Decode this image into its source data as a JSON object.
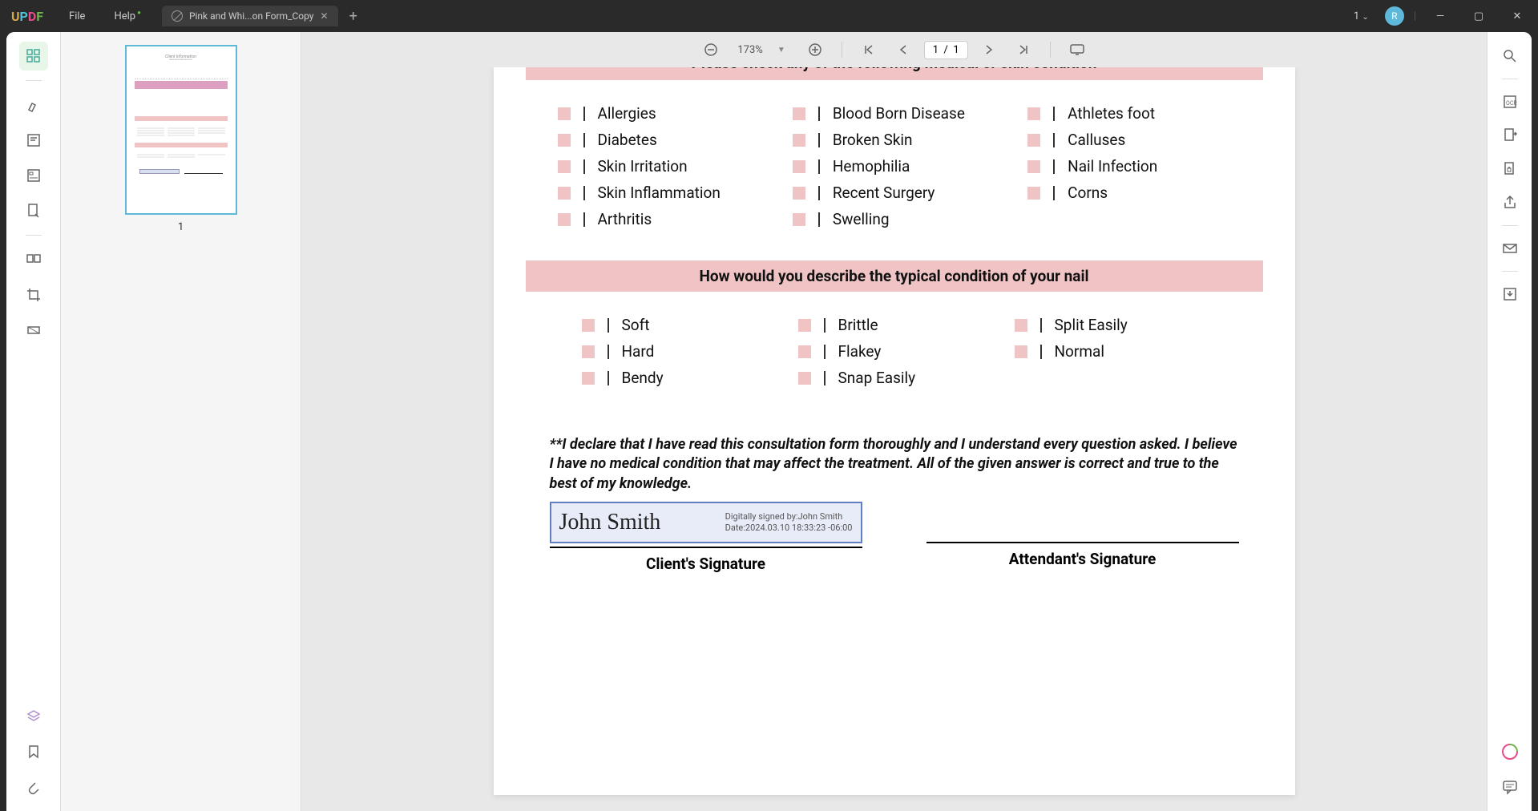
{
  "app": {
    "logo_chars": [
      "U",
      "P",
      "D",
      "F"
    ]
  },
  "menu": {
    "file": "File",
    "help": "Help"
  },
  "tab": {
    "title": "Pink and Whi...on Form_Copy"
  },
  "window": {
    "count": "1",
    "avatar": "R"
  },
  "toolbar": {
    "zoom": "173%",
    "page_current": "1",
    "page_sep": "/",
    "page_total": "1"
  },
  "thumbnail": {
    "page_num": "1"
  },
  "doc": {
    "section1_title": "Please check any of the following medical or skin condition",
    "medical_cols": [
      [
        "Allergies",
        "Diabetes",
        "Skin Irritation",
        "Skin Inflammation",
        "Arthritis"
      ],
      [
        "Blood Born Disease",
        "Broken Skin",
        "Hemophilia",
        "Recent Surgery",
        "Swelling"
      ],
      [
        "Athletes foot",
        "Calluses",
        "Nail Infection",
        "Corns"
      ]
    ],
    "section2_title": "How would you describe the typical condition of your nail",
    "nail_cols": [
      [
        "Soft",
        "Hard",
        "Bendy"
      ],
      [
        "Brittle",
        "Flakey",
        "Snap Easily"
      ],
      [
        "Split Easily",
        "Normal"
      ]
    ],
    "declaration": "**I declare that I have read this consultation form thoroughly and I understand every question asked. I believe I have no medical condition that may affect the treatment. All of the given answer is correct and true to the best of my knowledge.",
    "signature": {
      "name": "John Smith",
      "signed_by": "Digitally signed by:John Smith",
      "date": "Date:2024.03.10 18:33:23 -06:00",
      "client_label": "Client's Signature",
      "attendant_label": "Attendant's Signature"
    }
  }
}
